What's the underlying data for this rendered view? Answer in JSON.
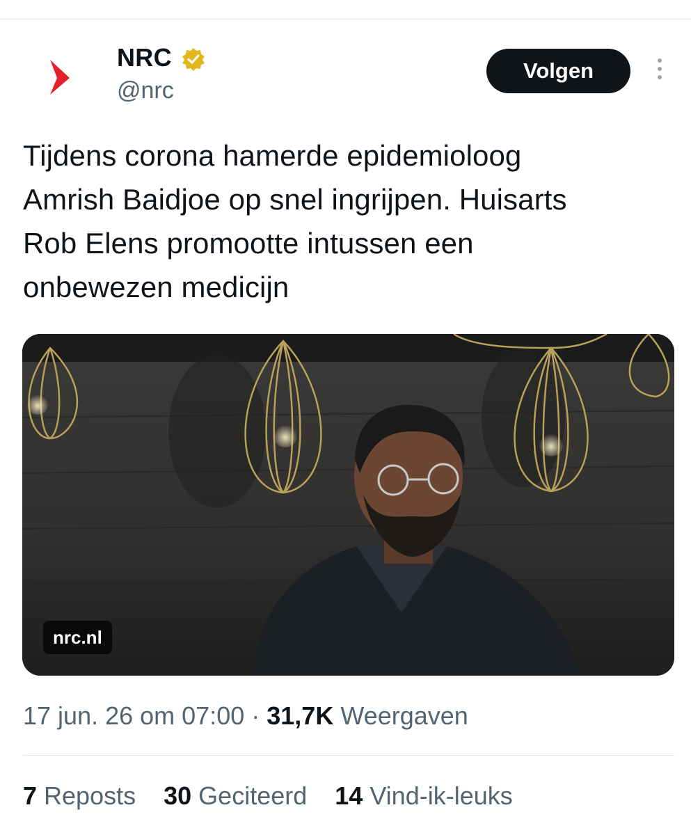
{
  "author": {
    "name": "NRC",
    "handle": "@nrc",
    "verified_color": "#e2b719",
    "logo_color": "#e4202a"
  },
  "actions": {
    "follow_label": "Volgen"
  },
  "tweet": {
    "text_lines": [
      "Tijdens corona hamerde epidemioloog",
      "Amrish Baidjoe op snel ingrijpen. Huisarts",
      "Rob Elens promootte intussen een",
      "onbewezen medicijn"
    ]
  },
  "media": {
    "domain": "nrc.nl"
  },
  "meta": {
    "datetime": "17 jun. 26 om 07:00",
    "separator": "·",
    "views_count": "31,7K",
    "views_label": "Weergaven"
  },
  "stats": [
    {
      "count": "7",
      "label": "Reposts"
    },
    {
      "count": "30",
      "label": "Geciteerd"
    },
    {
      "count": "14",
      "label": "Vind-ik-leuks"
    }
  ]
}
